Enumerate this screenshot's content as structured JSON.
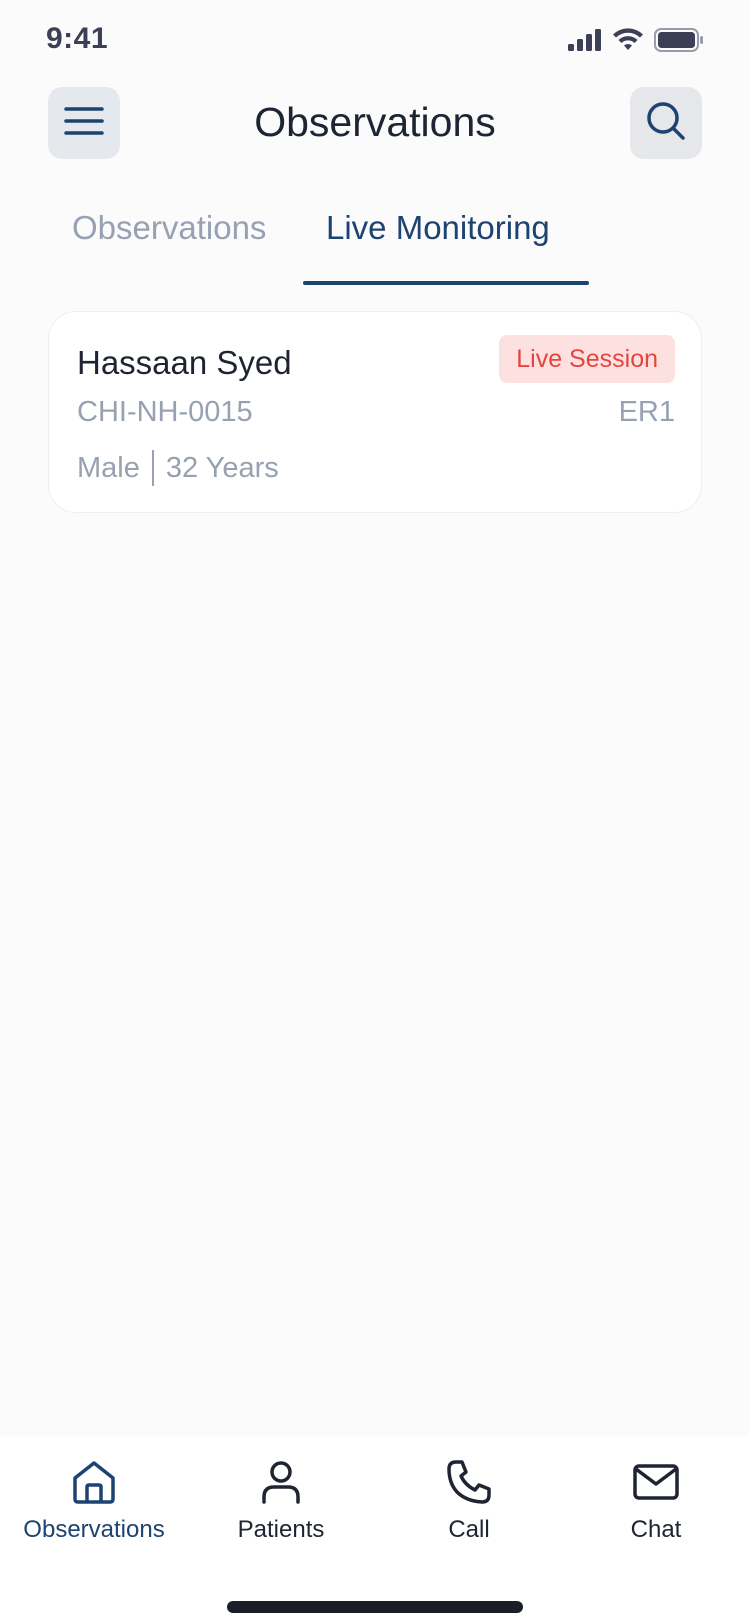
{
  "status_bar": {
    "time": "9:41"
  },
  "header": {
    "title": "Observations"
  },
  "tabs": [
    {
      "label": "Observations",
      "active": false
    },
    {
      "label": "Live Monitoring",
      "active": true
    }
  ],
  "patients": [
    {
      "name": "Hassaan Syed",
      "badge": "Live Session",
      "id": "CHI-NH-0015",
      "room": "ER1",
      "gender": "Male",
      "age": "32 Years"
    }
  ],
  "bottom_nav": [
    {
      "label": "Observations",
      "icon": "home-icon",
      "active": true
    },
    {
      "label": "Patients",
      "icon": "person-icon",
      "active": false
    },
    {
      "label": "Call",
      "icon": "phone-icon",
      "active": false
    },
    {
      "label": "Chat",
      "icon": "mail-icon",
      "active": false
    }
  ],
  "colors": {
    "primary": "#1d4370",
    "muted": "#97a1b3",
    "badge_bg": "#fde1e0",
    "badge_text": "#e5453e",
    "background": "#fbfbfb"
  }
}
